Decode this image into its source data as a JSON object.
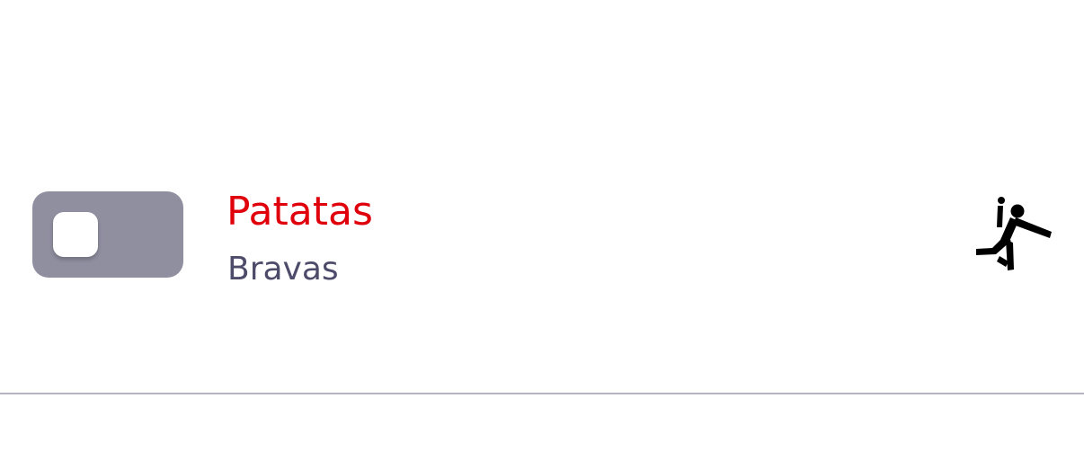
{
  "colors": {
    "toggle_off": "#908fa0",
    "title": "#e0000b",
    "subtitle": "#4d4b6a",
    "icon": "#000000",
    "divider": "#b5b4c2"
  },
  "toggle": {
    "state": "off"
  },
  "item": {
    "title": "Patatas",
    "subtitle": "Bravas",
    "icon": "handball-player-icon"
  }
}
